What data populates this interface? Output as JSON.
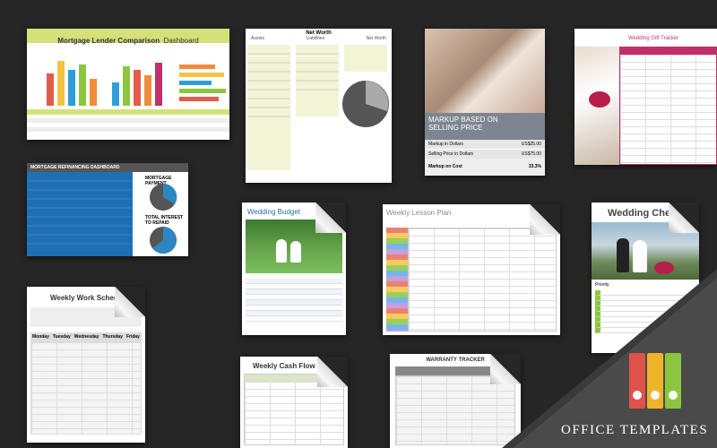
{
  "tiles": {
    "mortgage_comparison": {
      "title": "Mortgage Lender Comparison",
      "title_suffix": "Dashboard"
    },
    "net_worth": {
      "title": "Net Worth",
      "col_assets": "Assets",
      "col_liabilities": "Liabilities",
      "col_networth": "Net Worth"
    },
    "markup": {
      "title_line1": "MARKUP BASED ON",
      "title_line2": "SELLING PRICE",
      "row1_label": "Markup in Dollars",
      "row1_value": "US$25.00",
      "row2_label": "Selling Price in Dollars",
      "row2_value": "US$75.00",
      "row3_label": "Markup on Cost",
      "row3_value": "33.3%"
    },
    "wedding_gift": {
      "title": "Wedding Gift Tracker"
    },
    "refinancing": {
      "title": "MORTGAGE REFINANCING DASHBOARD",
      "label_payment": "MORTGAGE PAYMENT",
      "label_interest": "TOTAL INTEREST TO REPAID"
    },
    "wedding_budget": {
      "title": "Wedding Budget"
    },
    "lesson_plan": {
      "title": "Weekly Lesson Plan"
    },
    "wedding_checklist": {
      "title": "Wedding Check",
      "label_priority": "Priority"
    },
    "work_schedule": {
      "title": "Weekly Work Sched",
      "days": [
        "Monday",
        "Tuesday",
        "Wednesday",
        "Thursday",
        "Friday"
      ]
    },
    "cash_flow": {
      "title": "Weekly Cash Flow Pr"
    },
    "warranty": {
      "title": "WARRANTY TRACKER"
    }
  },
  "badge": {
    "label": "OFFICE TEMPLATES",
    "binder_colors": [
      "#e0524c",
      "#f0b429",
      "#8cc63f"
    ]
  },
  "colors": {
    "background": "#262626",
    "accent_blue": "#1f6fb5",
    "accent_pink": "#c0306a"
  }
}
